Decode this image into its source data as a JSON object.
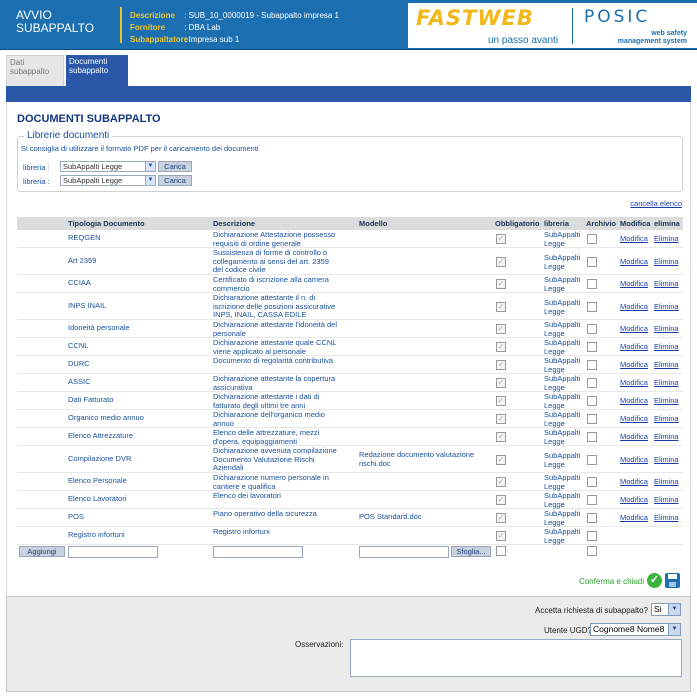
{
  "header": {
    "app_title": "AVVIO SUBAPPALTO",
    "meta": [
      {
        "key": "Descrizione",
        "value": ": SUB_10_0000019 - Subappalto impresa 1"
      },
      {
        "key": "Fornitore",
        "value": ": DBA Lab"
      },
      {
        "key": "Subappaltatore",
        "value": ": Impresa sub 1"
      }
    ],
    "brand_logo": "FASTWEB",
    "brand_slogan": "un passo avanti",
    "product_logo": "POSIC",
    "product_sub_1": "web safety",
    "product_sub_2": "management system"
  },
  "tabs": [
    {
      "label": "Dati subappalto",
      "active": false
    },
    {
      "label": "Documenti subappalto",
      "active": true
    }
  ],
  "page_title": "DOCUMENTI SUBAPPALTO",
  "libraries": {
    "legend": "Librerie documenti",
    "hint": "Si consiglia di utilizzare il formato PDF per il caricamento dei documenti",
    "rows": [
      {
        "label": "libreria :",
        "selected": "SubAppalti Legge",
        "button": "Carica"
      },
      {
        "label": "libreria :",
        "selected": "SubAppalti Legge",
        "button": "Carica"
      }
    ]
  },
  "cancel_link": "cancella elenco",
  "table": {
    "headers": [
      "Tipologia Documento",
      "Descrizione",
      "Modello",
      "Obbligatorio",
      "libreria",
      "Archivio",
      "Modifica",
      "elimina"
    ],
    "rows": [
      {
        "tipo": "REQGEN",
        "descrizione": [
          "Dichiarazione Attestazione possesso",
          "requisiti di ordine generale"
        ],
        "modello": [],
        "libreria": [
          "SubAppalti",
          "Legge"
        ],
        "modifica": "Modifica",
        "elimina": "Elimina"
      },
      {
        "tipo": "Art 2359",
        "descrizione": [
          "Sussistenza di forme di controllo o",
          "collegamento ai sensi del art. 2359",
          "del codice civile"
        ],
        "modello": [],
        "libreria": [
          "SubAppalti",
          "Legge"
        ],
        "modifica": "Modifica",
        "elimina": "Elimina"
      },
      {
        "tipo": "CCIAA",
        "descrizione": [
          "Certificato di iscrizione alla camera",
          "commercio"
        ],
        "modello": [],
        "libreria": [
          "SubAppalti",
          "Legge"
        ],
        "modifica": "Modifica",
        "elimina": "Elimina"
      },
      {
        "tipo": "INPS INAIL",
        "descrizione": [
          "Dichiarazione attestante il n. di",
          "iscrizione delle posizioni assicurative",
          "INPS, INAIL, CASSA EDILE"
        ],
        "modello": [],
        "libreria": [
          "SubAppalti",
          "Legge"
        ],
        "modifica": "Modifica",
        "elimina": "Elimina"
      },
      {
        "tipo": "Idoneità personale",
        "descrizione": [
          "Dichiarazione attestante l'idoneità del",
          "personale"
        ],
        "modello": [],
        "libreria": [
          "SubAppalti",
          "Legge"
        ],
        "modifica": "Modifica",
        "elimina": "Elimina"
      },
      {
        "tipo": "CCNL",
        "descrizione": [
          "Dichiarazione attestante quale CCNL",
          "viene applicato al personale"
        ],
        "modello": [],
        "libreria": [
          "SubAppalti",
          "Legge"
        ],
        "modifica": "Modifica",
        "elimina": "Elimina"
      },
      {
        "tipo": "DURC",
        "descrizione": [
          "Documento di regolarità contributiva"
        ],
        "modello": [],
        "libreria": [
          "SubAppalti",
          "Legge"
        ],
        "modifica": "Modifica",
        "elimina": "Elimina"
      },
      {
        "tipo": "ASSIC",
        "descrizione": [
          "Dichiarazione attestante la copertura",
          "assicurativa"
        ],
        "modello": [],
        "libreria": [
          "SubAppalti",
          "Legge"
        ],
        "modifica": "Modifica",
        "elimina": "Elimina"
      },
      {
        "tipo": "Dati Fatturato",
        "descrizione": [
          "Dichiarazione attestante i dati di",
          "fatturato degli ultimi tre anni"
        ],
        "modello": [],
        "libreria": [
          "SubAppalti",
          "Legge"
        ],
        "modifica": "Modifica",
        "elimina": "Elimina"
      },
      {
        "tipo": "Organico medio annuo",
        "descrizione": [
          "Dichiarazione dell'organico medio",
          "annuo"
        ],
        "modello": [],
        "libreria": [
          "SubAppalti",
          "Legge"
        ],
        "modifica": "Modifica",
        "elimina": "Elimina"
      },
      {
        "tipo": "Elenco Attrezzature",
        "descrizione": [
          "Elenco delle attrezzature, mezzi",
          "d'opera, equipaggiamenti"
        ],
        "modello": [],
        "libreria": [
          "SubAppalti",
          "Legge"
        ],
        "modifica": "Modifica",
        "elimina": "Elimina"
      },
      {
        "tipo": "Compilazione DVR",
        "descrizione": [
          "Dichiarazione avvenuta compilazione",
          "Documento Valutazione Rischi",
          "Aziendali"
        ],
        "modello": [
          "Redazione documento valutazione",
          "rischi.doc"
        ],
        "libreria": [
          "SubAppalti",
          "Legge"
        ],
        "modifica": "Modifica",
        "elimina": "Elimina"
      },
      {
        "tipo": "Elenco Personale",
        "descrizione": [
          "Dichiarazione numero personale in",
          "cantiere e qualifica"
        ],
        "modello": [],
        "libreria": [
          "SubAppalti",
          "Legge"
        ],
        "modifica": "Modifica",
        "elimina": "Elimina"
      },
      {
        "tipo": "Elenco Lavoratori",
        "descrizione": [
          "Elenco dei lavoratori"
        ],
        "modello": [],
        "libreria": [
          "SubAppalti",
          "Legge"
        ],
        "modifica": "Modifica",
        "elimina": "Elimina"
      },
      {
        "tipo": "POS",
        "descrizione": [
          "Piano operativo della sicurezza"
        ],
        "modello": [
          "POS Standard.doc"
        ],
        "libreria": [
          "SubAppalti",
          "Legge"
        ],
        "modifica": "Modifica",
        "elimina": "Elimina"
      },
      {
        "tipo": "Registro infortuni",
        "descrizione": [
          "Registro infortuni"
        ],
        "modello": [],
        "libreria": [
          "SubAppalti",
          "Legge"
        ],
        "modifica": "",
        "elimina": ""
      }
    ],
    "add_button": "Aggiungi",
    "browse_button": "Sfoglia..."
  },
  "confirm_label": "Conferma e chiudi",
  "form": {
    "accept_label": "Accetta richiesta di subappalto?",
    "accept_value": "Si",
    "user_label": "Utente UGD?",
    "user_value": "Cognome8 Nome8",
    "notes_label": "Osservazioni:"
  },
  "colors": {
    "header_blue": "#1b6fb0",
    "band_blue": "#2a57a8",
    "accent_yellow": "#f2b71a",
    "confirm_green": "#2c9a2c"
  }
}
